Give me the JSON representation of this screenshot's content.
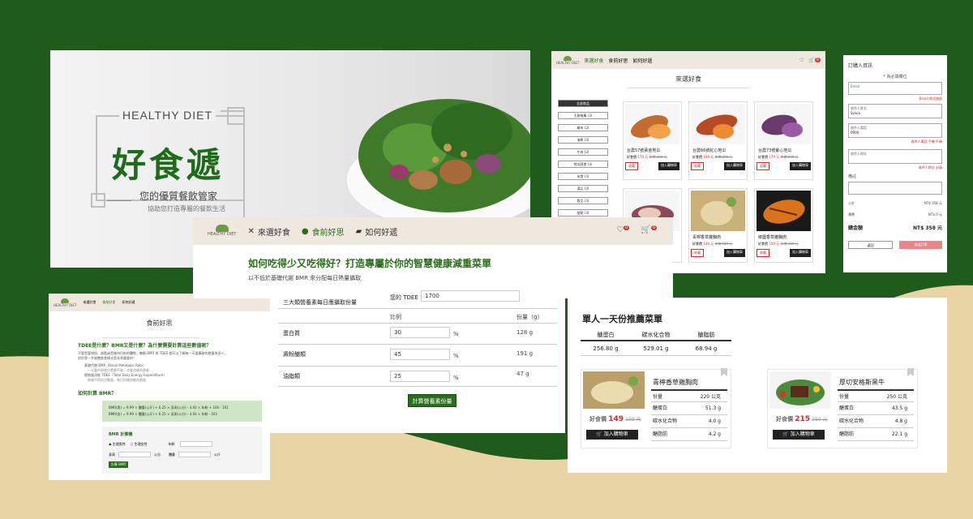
{
  "colors": {
    "brand_green": "#1e5b1c",
    "accent_green": "#2a6d1c",
    "sand": "#e8d4a4",
    "red": "#d02a2a",
    "header_bg": "#efe8de"
  },
  "hero": {
    "brand_en": "HEALTHY DIET",
    "brand_cn": "好食遞",
    "tagline": "您的優質餐飲管家",
    "subtitle": "協助您打造專屬的餐飲生活"
  },
  "shop": {
    "logo": "HEALTHY DIET",
    "nav": [
      "來選好食",
      "食前好思",
      "如何好遞"
    ],
    "cart_badge": "0",
    "title": "來選好食",
    "categories": [
      {
        "label": "全部商品"
      },
      {
        "label": "主廚推薦 (3)"
      },
      {
        "label": "雞肉 (3)"
      },
      {
        "label": "海鮮 (3)"
      },
      {
        "label": "牛肉 (3)"
      },
      {
        "label": "地瓜蔬食 (3)"
      },
      {
        "label": "米食 (3)"
      },
      {
        "label": "湯品 (3)"
      },
      {
        "label": "飲品 (3)"
      },
      {
        "label": "甜點 (3)"
      }
    ],
    "products": [
      {
        "name": "台農57號黃金地瓜",
        "price_label": "好食價",
        "price": "179 元",
        "orig": "原價 200 元",
        "img": "sweet-potato-yellow"
      },
      {
        "name": "台農66號紅心地瓜",
        "price_label": "好食價",
        "price": "169 元",
        "orig": "原價 200 元",
        "img": "sweet-potato-red"
      },
      {
        "name": "台農73號紫心地瓜",
        "price_label": "好食價",
        "price": "179 元",
        "orig": "原價 200 元",
        "img": "sweet-potato-purple"
      },
      {
        "name": "",
        "price_label": "",
        "price": "",
        "orig": "",
        "img": "sweet-potato-slice"
      },
      {
        "name": "青檸香草雞胸肉",
        "price_label": "好食價",
        "price": "149 元",
        "orig": "原價 159 元",
        "img": "chicken-lime"
      },
      {
        "name": "椒鹽香草雞胸肉",
        "price_label": "好食價",
        "price": "159 元",
        "orig": "原價 159 元",
        "img": "chicken-pepper"
      }
    ],
    "fav_label": "收藏",
    "cart_label": "加入購物車"
  },
  "order": {
    "title": "訂購人資訊",
    "required_note": "* 為必填欄位",
    "email_label": "Email",
    "email_error": "Email 格式錯誤",
    "name_label": "收件人姓名",
    "name_value": "Sylvia",
    "phone_label": "收件人電話",
    "phone_value": "0900",
    "phone_error": "收件人電話 手機 9 碼",
    "address_label": "收件人地址",
    "address_error": "收件人地址 必填",
    "note_label": "備註",
    "subtotal_label": "小計",
    "subtotal_value": "NT$ 358 元",
    "shipping_label": "運費",
    "shipping_value": "NT$ 0 元",
    "total_label": "總金額",
    "total_value": "NT$ 358 元",
    "back_label": "返回",
    "submit_label": "送出訂單"
  },
  "center": {
    "logo": "HEALTHY DIET",
    "nav": [
      "來選好食",
      "食前好思",
      "如何好遞"
    ],
    "fav_badge": "0",
    "cart_badge": "0",
    "title": "如何吃得少又吃得好？打造專屬於你的智慧健康減重菜單",
    "subtitle": "以不低於基礎代謝 BMR 來分配每日熱量攝取"
  },
  "calc": {
    "heading": "三大類營養素每日應攝取份量",
    "tdee_label": "您的 TDEE",
    "tdee_value": "1700",
    "col_ratio": "比例",
    "col_amount": "份量（g）",
    "rows": [
      {
        "label": "蛋白質",
        "ratio": "30",
        "unit": "%",
        "amount": "128 g"
      },
      {
        "label": "澱粉醣類",
        "ratio": "45",
        "unit": "%",
        "amount": "191 g"
      },
      {
        "label": "油脂類",
        "ratio": "25",
        "unit": "%",
        "amount": "47 g"
      }
    ],
    "button": "計算營養素份量"
  },
  "info": {
    "logo": "HEALTHY DIET",
    "nav": [
      "來選好食",
      "食前好思",
      "如何好遞"
    ],
    "title": "食前好思",
    "q1": "TDEE是什麼？BMR又是什麼？為什麼需要計算這些數值呢？",
    "p1a": "不管是要增肌、減脂或是維持目前的體態，瞭解 BMR 與 TDEE 都可以了解每一天要攝取的熱量為多少，",
    "p1b": "對於第一步調整飲食模式是非常重要的！",
    "b1": "基礎代謝 BMR（Basal Metabolic Rate）",
    "b1d": "一天當中即使什麼都不做，也會消耗的熱量",
    "b2": "總熱量消耗 TDEE（Total Daily Energy Expenditure）",
    "b2d": "依據不同的活動量，每日所需消耗的熱量",
    "q2": "如何計算 BMR？",
    "f1": "BMR(男) = 9.99 × 體重(公斤) + 6.25 × 身高(公分) - 4.92 × 年齡 + 166 - 161",
    "f2": "BMR(女) = 9.99 × 體重(公斤) + 6.25 × 身高(公分) - 4.92 × 年齡 - 161",
    "calc_title": "BMR 計算機",
    "male": "生理男性",
    "female": "生理女性",
    "age": "年齡",
    "height": "身高",
    "cm": "公分",
    "weight": "體重",
    "kg": "公斤",
    "calc_btn": "計算 BMR"
  },
  "rec": {
    "title": "單人一天份推薦菜單",
    "headers": [
      "醣蛋白",
      "碳水化合物",
      "醣脂肪"
    ],
    "values": [
      "256.80 g",
      "529.01 g",
      "68.94 g"
    ],
    "meals": [
      {
        "name": "青檸香草雞胸肉",
        "price_label": "好食價",
        "price": "149",
        "orig": "159 元",
        "cart": "加入購物車",
        "rows": [
          {
            "k": "份量",
            "v": "220 公克"
          },
          {
            "k": "醣蛋白",
            "v": "51.3 g"
          },
          {
            "k": "碳水化合物",
            "v": "4.0 g"
          },
          {
            "k": "醣脂肪",
            "v": "4.2 g"
          }
        ]
      },
      {
        "name": "厚切安格斯黑牛",
        "price_label": "好食價",
        "price": "215",
        "orig": "250 元",
        "cart": "加入購物車",
        "rows": [
          {
            "k": "份量",
            "v": "250 公克"
          },
          {
            "k": "醣蛋白",
            "v": "43.5 g"
          },
          {
            "k": "碳水化合物",
            "v": "4.8 g"
          },
          {
            "k": "醣脂肪",
            "v": "22.1 g"
          }
        ]
      }
    ]
  }
}
